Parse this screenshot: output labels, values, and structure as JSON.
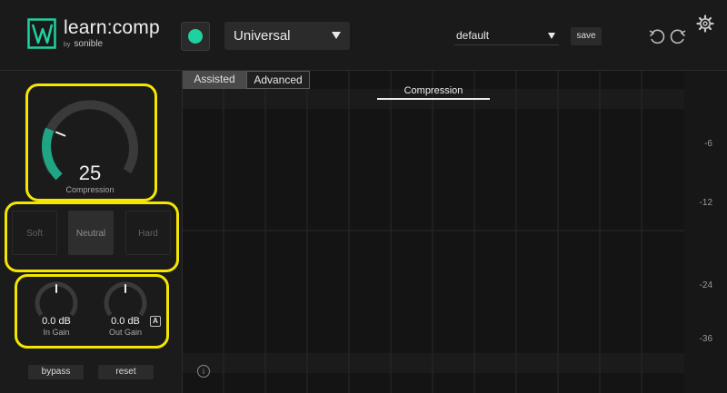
{
  "header": {
    "app_name": "learn:comp",
    "by_label": "by",
    "brand": "sonible",
    "profile": {
      "selected": "Universal"
    },
    "preset": {
      "selected": "default"
    },
    "save_label": "save"
  },
  "colors": {
    "accent": "#1fd1a0",
    "highlight": "#f4e600"
  },
  "controls": {
    "compression": {
      "value": "25",
      "label": "Compression",
      "level_fraction": 0.25
    },
    "styles": [
      {
        "label": "Soft",
        "active": false
      },
      {
        "label": "Neutral",
        "active": true
      },
      {
        "label": "Hard",
        "active": false
      }
    ],
    "in_gain": {
      "value": "0.0 dB",
      "label": "In Gain"
    },
    "out_gain": {
      "value": "0.0 dB",
      "label": "Out Gain",
      "auto_badge": "A"
    },
    "bypass_label": "bypass",
    "reset_label": "reset"
  },
  "graph": {
    "tabs": [
      {
        "label": "Assisted",
        "active": true
      },
      {
        "label": "Advanced",
        "active": false
      }
    ],
    "title": "Compression",
    "info_glyph": "i",
    "db_scale": [
      "-6",
      "-12",
      "-24",
      "-36"
    ]
  },
  "icons": [
    "sonible-logo-icon",
    "power-icon",
    "dropdown-caret-icon",
    "undo-icon",
    "redo-icon",
    "gear-icon",
    "info-icon"
  ]
}
